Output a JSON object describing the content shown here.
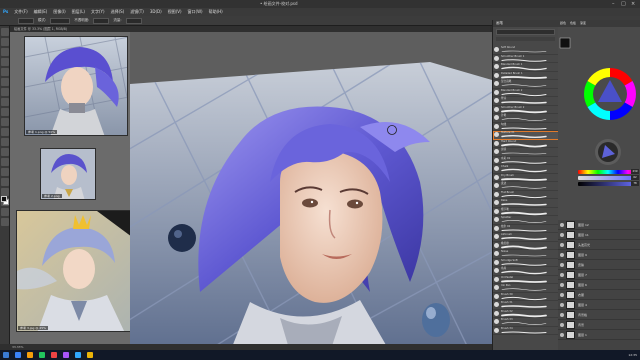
{
  "app": {
    "title": "• 绘画文件-校对.psd",
    "menu": [
      "文件(F)",
      "编辑(E)",
      "图像(I)",
      "图层(L)",
      "文字(Y)",
      "选择(S)",
      "滤镜(T)",
      "3D(D)",
      "视图(V)",
      "窗口(W)",
      "帮助(H)"
    ],
    "option_labels": [
      "模式:",
      "正常",
      "不透明度:",
      "流量:"
    ],
    "tab": "绘画文件 @ 33.3% (图层 1, RGB/8)",
    "status": "33.33%"
  },
  "references": [
    {
      "caption": "参考 1.png @ 50%"
    },
    {
      "caption": "参考 2.png"
    },
    {
      "caption": "参考 3.jpg @ 25%"
    }
  ],
  "brushes": {
    "title": "画笔",
    "items": [
      {
        "name": "Soft Round",
        "selected": false
      },
      {
        "name": "Smoother Brush 1",
        "selected": false
      },
      {
        "name": "Blended Brush 1",
        "selected": false
      },
      {
        "name": "Detailed Brush 1",
        "selected": false
      },
      {
        "name": "混合画笔",
        "selected": false
      },
      {
        "name": "Blended Brush 2",
        "selected": false
      },
      {
        "name": "厚涂",
        "selected": false
      },
      {
        "name": "Smoother Brush 2",
        "selected": false
      },
      {
        "name": "针笔",
        "selected": false
      },
      {
        "name": "勾线",
        "selected": false
      },
      {
        "name": "Texture 01",
        "selected": true
      },
      {
        "name": "Hard Round",
        "selected": false
      },
      {
        "name": "斑驳",
        "selected": false
      },
      {
        "name": "水彩 01",
        "selected": false
      },
      {
        "name": "Chalk",
        "selected": false
      },
      {
        "name": "Dry Brush",
        "selected": false
      },
      {
        "name": "柔边",
        "selected": false
      },
      {
        "name": "Flat Brush",
        "selected": false
      },
      {
        "name": "Rake",
        "selected": false
      },
      {
        "name": "细节笔",
        "selected": false
      },
      {
        "name": "Splatter",
        "selected": false
      },
      {
        "name": "线条 02",
        "selected": false
      },
      {
        "name": "Airbrush",
        "selected": false
      },
      {
        "name": "橡皮擦",
        "selected": false
      },
      {
        "name": "Noise",
        "selected": false
      },
      {
        "name": "Smudge Soft",
        "selected": false
      },
      {
        "name": "卷尾",
        "selected": false
      },
      {
        "name": "Oil Pastel",
        "selected": false
      },
      {
        "name": "Ink Pen",
        "selected": false
      },
      {
        "name": "Brush 30",
        "selected": false
      },
      {
        "name": "Brush 31",
        "selected": false
      },
      {
        "name": "Brush 32",
        "selected": false
      },
      {
        "name": "Brush 33",
        "selected": false
      },
      {
        "name": "Brush 34",
        "selected": false
      }
    ]
  },
  "color": {
    "tabs": [
      "颜色",
      "色板",
      "渐变"
    ],
    "foreground": "#111111",
    "background": "#ffffff",
    "accent": "#4a50c8",
    "sliders": [
      {
        "label": "H",
        "value": "239",
        "gradient": "linear-gradient(90deg,#f00,#ff0,#0f0,#0ff,#00f,#f0f,#f00)"
      },
      {
        "label": "S",
        "value": "62",
        "gradient": "linear-gradient(90deg,#ddd,#5c64ff)"
      },
      {
        "label": "B",
        "value": "78",
        "gradient": "linear-gradient(90deg,#000,#6a70ff)"
      }
    ]
  },
  "layers": {
    "items": [
      {
        "name": "图层 12"
      },
      {
        "name": "图层 11"
      },
      {
        "name": "头发高光"
      },
      {
        "name": "图层 9"
      },
      {
        "name": "皮肤"
      },
      {
        "name": "图层 7"
      },
      {
        "name": "图层 6"
      },
      {
        "name": "衣服"
      },
      {
        "name": "图层 4"
      },
      {
        "name": "背景格"
      },
      {
        "name": "背景"
      },
      {
        "name": "图层 1"
      }
    ]
  },
  "taskbar": {
    "clock": "12:35",
    "icons": [
      "#3b82f6",
      "#f59e0b",
      "#22c55e",
      "#ef4444",
      "#a855f7",
      "#31a8ff",
      "#eab308"
    ]
  }
}
